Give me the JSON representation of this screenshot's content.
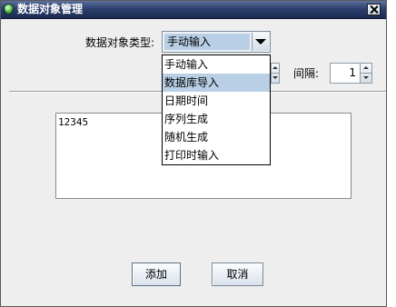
{
  "window": {
    "title": "数据对象管理"
  },
  "form": {
    "type_label": "数据对象类型:",
    "type_select": {
      "selected": "手动输入",
      "options": [
        "手动输入",
        "数据库导入",
        "日期时间",
        "序列生成",
        "随机生成",
        "打印时输入"
      ],
      "highlighted_index": 1
    },
    "interval_label": "间隔:",
    "interval_value": "1"
  },
  "content": {
    "text": "12345"
  },
  "buttons": {
    "add_label": "添加",
    "cancel_label": "取消"
  },
  "icons": {
    "app": "app-droplet-icon",
    "close": "close-icon",
    "dropdown": "chevron-down-icon",
    "spinner_up": "spinner-up-icon",
    "spinner_down": "spinner-down-icon"
  },
  "colors": {
    "title_bar": "#24365f",
    "body": "#eeeeee",
    "selection": "#b8cfe5"
  }
}
